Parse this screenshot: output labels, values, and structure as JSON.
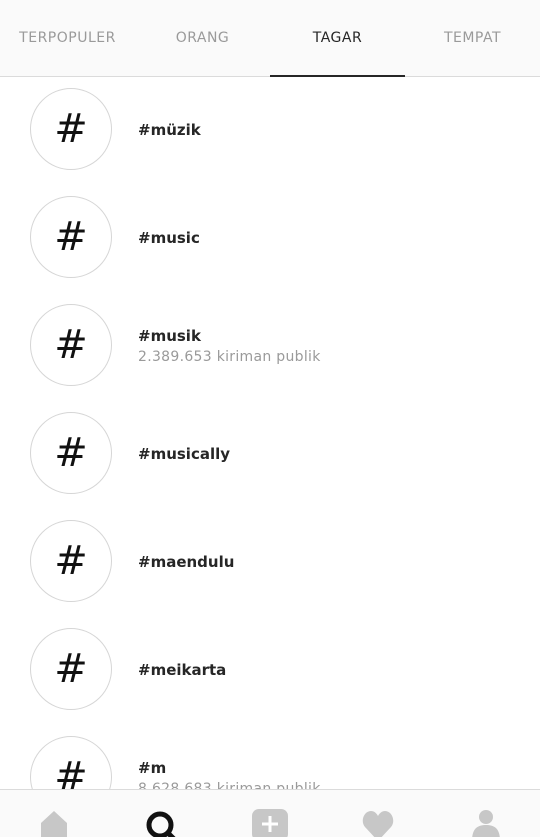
{
  "tabs": [
    {
      "label": "TERPOPULER",
      "active": false
    },
    {
      "label": "ORANG",
      "active": false
    },
    {
      "label": "TAGAR",
      "active": true
    },
    {
      "label": "TEMPAT",
      "active": false
    }
  ],
  "hashtags": [
    {
      "symbol": "#",
      "name": "#müzik",
      "count": ""
    },
    {
      "symbol": "#",
      "name": "#music",
      "count": ""
    },
    {
      "symbol": "#",
      "name": "#musik",
      "count": "2.389.653 kiriman publik"
    },
    {
      "symbol": "#",
      "name": "#musically",
      "count": ""
    },
    {
      "symbol": "#",
      "name": "#maendulu",
      "count": ""
    },
    {
      "symbol": "#",
      "name": "#meikarta",
      "count": ""
    },
    {
      "symbol": "#",
      "name": "#m",
      "count": "8.628.683 kiriman publik"
    }
  ],
  "bottom_nav": [
    {
      "icon": "home-icon",
      "active": false
    },
    {
      "icon": "search-icon",
      "active": true
    },
    {
      "icon": "add-post-icon",
      "active": false
    },
    {
      "icon": "heart-icon",
      "active": false
    },
    {
      "icon": "profile-icon",
      "active": false
    }
  ],
  "colors": {
    "active_text": "#262626",
    "inactive_text": "#9a9a9a",
    "inactive_icon": "#c7c7c7"
  }
}
